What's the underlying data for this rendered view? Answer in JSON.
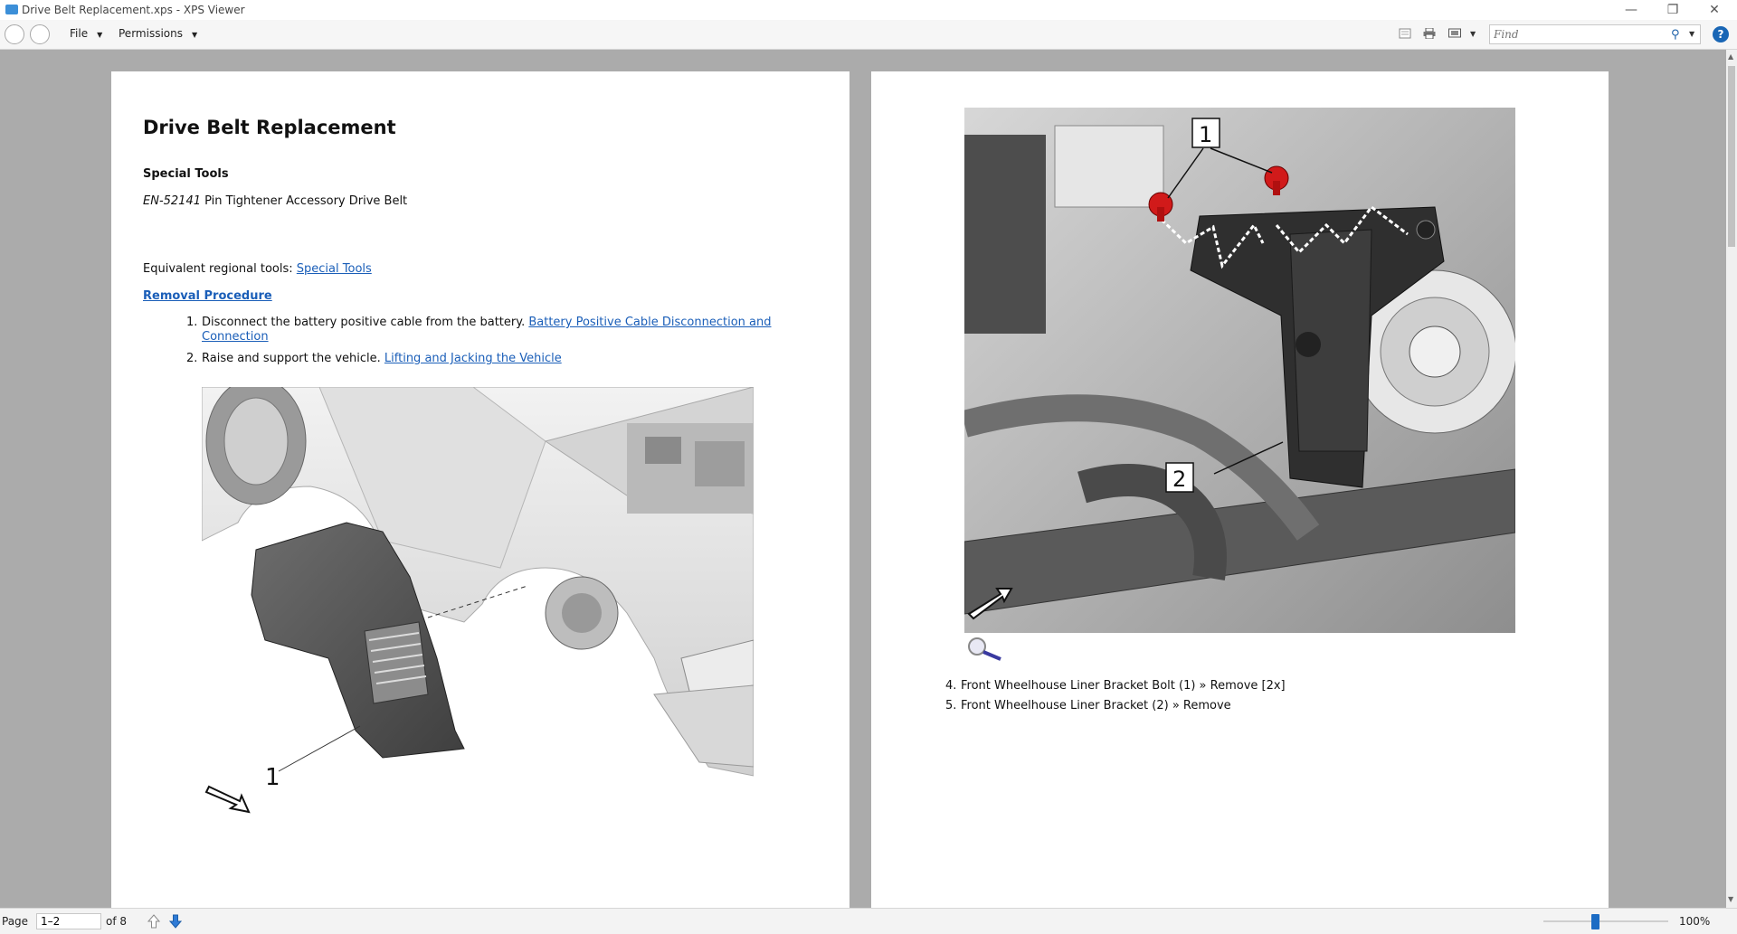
{
  "window": {
    "title": "Drive Belt Replacement.xps - XPS Viewer",
    "controls": [
      "—",
      "❐",
      "✕"
    ]
  },
  "menubar": {
    "file_label": "File",
    "permissions_label": "Permissions",
    "find_placeholder": "Find"
  },
  "page1": {
    "title": "Drive Belt Replacement",
    "special_tools_heading": "Special Tools",
    "tool_code": "EN-52141",
    "tool_name": " Pin Tightener Accessory Drive Belt",
    "equivalent_prefix": "Equivalent regional tools: ",
    "equivalent_link": "Special Tools",
    "removal_heading": "Removal Procedure",
    "steps": [
      {
        "num": "1.",
        "text": "Disconnect the battery positive cable from the battery. ",
        "link_line1": "Battery Positive Cable Disconnection and",
        "link_line2": "Connection"
      },
      {
        "num": "2.",
        "text": "Raise and support the vehicle. ",
        "link": "Lifting and Jacking the Vehicle"
      }
    ],
    "figure_callout": "1"
  },
  "page2": {
    "callout_1": "1",
    "callout_2": "2",
    "steps": [
      {
        "num": "4.",
        "text": "Front Wheelhouse Liner Bracket Bolt (1) » Remove [2x]"
      },
      {
        "num": "5.",
        "text": "Front Wheelhouse Liner Bracket (2) » Remove"
      }
    ]
  },
  "statusbar": {
    "page_label": "Page",
    "page_value": "1–2",
    "of_label": "of 8",
    "zoom": "100%",
    "zoom_fraction": 0.41
  }
}
